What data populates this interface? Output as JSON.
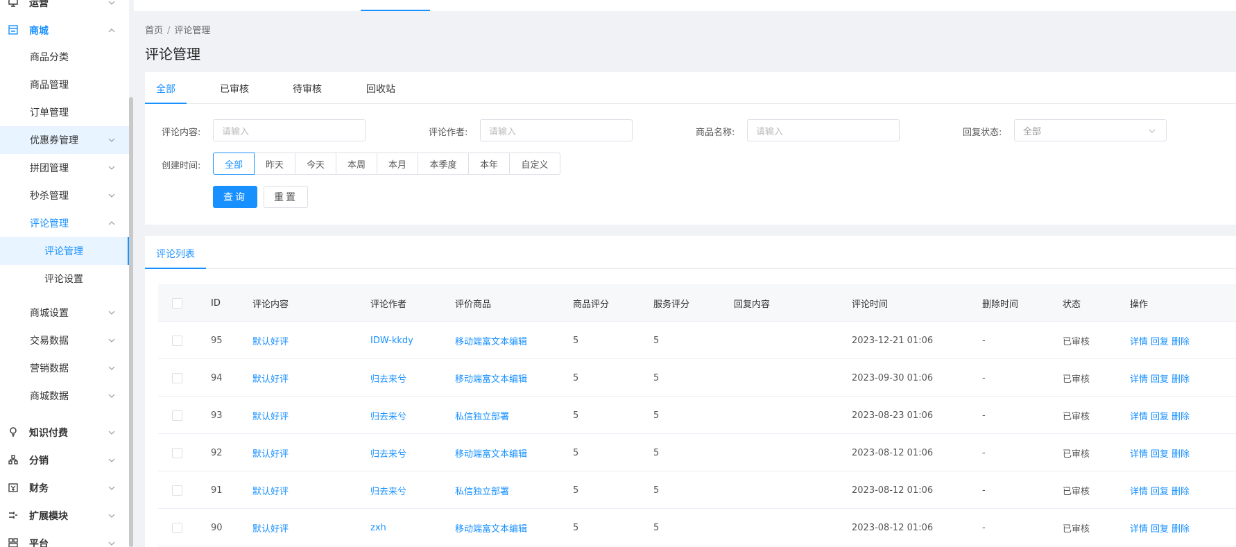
{
  "sidebar": {
    "top_items": [
      {
        "label": "运营",
        "icon": "monitor-icon"
      },
      {
        "label": "商城",
        "icon": "store-icon"
      },
      {
        "label": "知识付费",
        "icon": "lightbulb-icon"
      },
      {
        "label": "分销",
        "icon": "hierarchy-icon"
      },
      {
        "label": "财务",
        "icon": "finance-icon"
      },
      {
        "label": "扩展模块",
        "icon": "extension-icon"
      },
      {
        "label": "平台",
        "icon": "platform-icon"
      }
    ],
    "shop_items": [
      {
        "label": "商品分类"
      },
      {
        "label": "商品管理"
      },
      {
        "label": "订单管理"
      },
      {
        "label": "优惠券管理"
      },
      {
        "label": "拼团管理"
      },
      {
        "label": "秒杀管理"
      },
      {
        "label": "评论管理"
      },
      {
        "label": "评论管理"
      },
      {
        "label": "评论设置"
      },
      {
        "label": "商城设置"
      },
      {
        "label": "交易数据"
      },
      {
        "label": "营销数据"
      },
      {
        "label": "商城数据"
      }
    ]
  },
  "breadcrumb": {
    "home": "首页",
    "separator": "/",
    "current": "评论管理"
  },
  "page_title": "评论管理",
  "tabs": [
    "全部",
    "已审核",
    "待审核",
    "回收站"
  ],
  "filters": {
    "content_label": "评论内容:",
    "content_placeholder": "请输入",
    "author_label": "评论作者:",
    "author_placeholder": "请输入",
    "product_label": "商品名称:",
    "product_placeholder": "请输入",
    "reply_label": "回复状态:",
    "reply_value": "全部",
    "time_label": "创建时间:",
    "time_options": [
      "全部",
      "昨天",
      "今天",
      "本周",
      "本月",
      "本季度",
      "本年",
      "自定义"
    ],
    "search_button": "查询",
    "reset_button": "重置"
  },
  "list": {
    "tab": "评论列表",
    "columns": [
      "ID",
      "评论内容",
      "评论作者",
      "评价商品",
      "商品评分",
      "服务评分",
      "回复内容",
      "评论时间",
      "删除时间",
      "状态",
      "操作"
    ],
    "rows": [
      {
        "id": "95",
        "content": "默认好评",
        "author": "IDW-kkdy",
        "product": "移动端富文本编辑",
        "product_score": "5",
        "service_score": "5",
        "reply": "",
        "time": "2023-12-21 01:06",
        "deleted": "-",
        "status": "已审核"
      },
      {
        "id": "94",
        "content": "默认好评",
        "author": "归去来兮",
        "product": "移动端富文本编辑",
        "product_score": "5",
        "service_score": "5",
        "reply": "",
        "time": "2023-09-30 01:06",
        "deleted": "-",
        "status": "已审核"
      },
      {
        "id": "93",
        "content": "默认好评",
        "author": "归去来兮",
        "product": "私信独立部署",
        "product_score": "5",
        "service_score": "5",
        "reply": "",
        "time": "2023-08-23 01:06",
        "deleted": "-",
        "status": "已审核"
      },
      {
        "id": "92",
        "content": "默认好评",
        "author": "归去来兮",
        "product": "移动端富文本编辑",
        "product_score": "5",
        "service_score": "5",
        "reply": "",
        "time": "2023-08-12 01:06",
        "deleted": "-",
        "status": "已审核"
      },
      {
        "id": "91",
        "content": "默认好评",
        "author": "归去来兮",
        "product": "私信独立部署",
        "product_score": "5",
        "service_score": "5",
        "reply": "",
        "time": "2023-08-12 01:06",
        "deleted": "-",
        "status": "已审核"
      },
      {
        "id": "90",
        "content": "默认好评",
        "author": "zxh",
        "product": "移动端富文本编辑",
        "product_score": "5",
        "service_score": "5",
        "reply": "",
        "time": "2023-08-12 01:06",
        "deleted": "-",
        "status": "已审核"
      }
    ],
    "actions": [
      "详情",
      "回复",
      "删除"
    ]
  },
  "colors": {
    "accent": "#1890ff",
    "background": "#f0f2f5",
    "hover": "#e8f4ff"
  }
}
